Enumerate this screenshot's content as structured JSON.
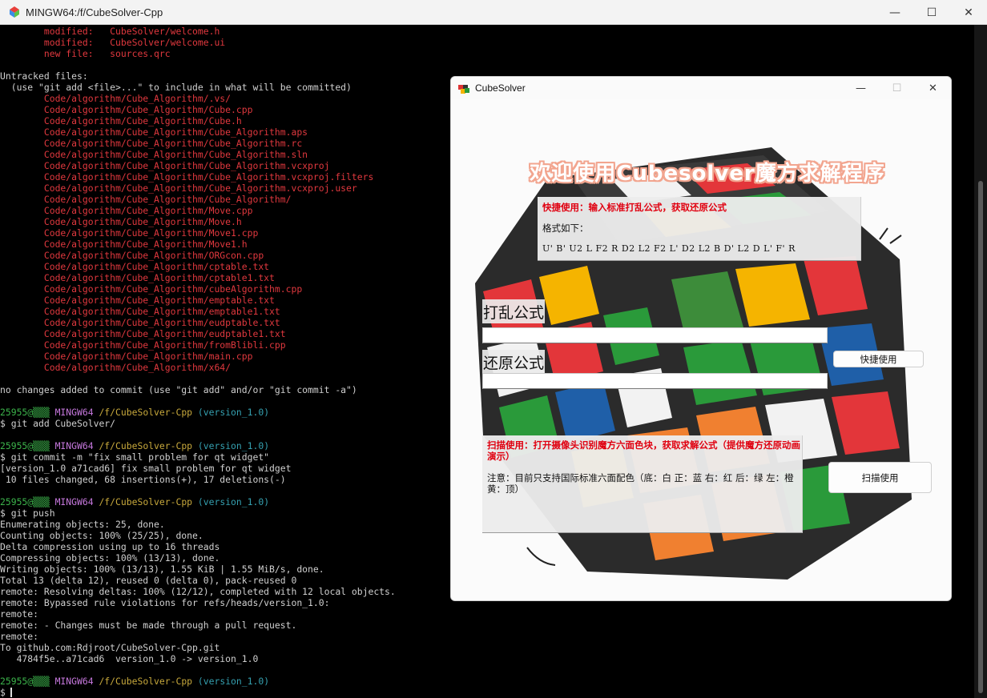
{
  "terminal_window": {
    "title": "MINGW64:/f/CubeSolver-Cpp",
    "controls": {
      "minimize": "—",
      "maximize": "☐",
      "close": "✕"
    }
  },
  "terminal": {
    "lines": [
      [
        [
          "c-red",
          "        modified:   CubeSolver/welcome.h"
        ]
      ],
      [
        [
          "c-red",
          "        modified:   CubeSolver/welcome.ui"
        ]
      ],
      [
        [
          "c-red",
          "        new file:   sources.qrc"
        ]
      ],
      [
        [
          "c-white",
          ""
        ]
      ],
      [
        [
          "c-white",
          "Untracked files:"
        ]
      ],
      [
        [
          "c-white",
          "  (use \"git add <file>...\" to include in what will be committed)"
        ]
      ],
      [
        [
          "c-red",
          "        Code/algorithm/Cube_Algorithm/.vs/"
        ]
      ],
      [
        [
          "c-red",
          "        Code/algorithm/Cube_Algorithm/Cube.cpp"
        ]
      ],
      [
        [
          "c-red",
          "        Code/algorithm/Cube_Algorithm/Cube.h"
        ]
      ],
      [
        [
          "c-red",
          "        Code/algorithm/Cube_Algorithm/Cube_Algorithm.aps"
        ]
      ],
      [
        [
          "c-red",
          "        Code/algorithm/Cube_Algorithm/Cube_Algorithm.rc"
        ]
      ],
      [
        [
          "c-red",
          "        Code/algorithm/Cube_Algorithm/Cube_Algorithm.sln"
        ]
      ],
      [
        [
          "c-red",
          "        Code/algorithm/Cube_Algorithm/Cube_Algorithm.vcxproj"
        ]
      ],
      [
        [
          "c-red",
          "        Code/algorithm/Cube_Algorithm/Cube_Algorithm.vcxproj.filters"
        ]
      ],
      [
        [
          "c-red",
          "        Code/algorithm/Cube_Algorithm/Cube_Algorithm.vcxproj.user"
        ]
      ],
      [
        [
          "c-red",
          "        Code/algorithm/Cube_Algorithm/Cube_Algorithm/"
        ]
      ],
      [
        [
          "c-red",
          "        Code/algorithm/Cube_Algorithm/Move.cpp"
        ]
      ],
      [
        [
          "c-red",
          "        Code/algorithm/Cube_Algorithm/Move.h"
        ]
      ],
      [
        [
          "c-red",
          "        Code/algorithm/Cube_Algorithm/Move1.cpp"
        ]
      ],
      [
        [
          "c-red",
          "        Code/algorithm/Cube_Algorithm/Move1.h"
        ]
      ],
      [
        [
          "c-red",
          "        Code/algorithm/Cube_Algorithm/ORGcon.cpp"
        ]
      ],
      [
        [
          "c-red",
          "        Code/algorithm/Cube_Algorithm/cptable.txt"
        ]
      ],
      [
        [
          "c-red",
          "        Code/algorithm/Cube_Algorithm/cptable1.txt"
        ]
      ],
      [
        [
          "c-red",
          "        Code/algorithm/Cube_Algorithm/cubeAlgorithm.cpp"
        ]
      ],
      [
        [
          "c-red",
          "        Code/algorithm/Cube_Algorithm/emptable.txt"
        ]
      ],
      [
        [
          "c-red",
          "        Code/algorithm/Cube_Algorithm/emptable1.txt"
        ]
      ],
      [
        [
          "c-red",
          "        Code/algorithm/Cube_Algorithm/eudptable.txt"
        ]
      ],
      [
        [
          "c-red",
          "        Code/algorithm/Cube_Algorithm/eudptable1.txt"
        ]
      ],
      [
        [
          "c-red",
          "        Code/algorithm/Cube_Algorithm/fromBlibli.cpp"
        ]
      ],
      [
        [
          "c-red",
          "        Code/algorithm/Cube_Algorithm/main.cpp"
        ]
      ],
      [
        [
          "c-red",
          "        Code/algorithm/Cube_Algorithm/x64/"
        ]
      ],
      [
        [
          "c-white",
          ""
        ]
      ],
      [
        [
          "c-white",
          "no changes added to commit (use \"git add\" and/or \"git commit -a\")"
        ]
      ],
      [
        [
          "c-white",
          ""
        ]
      ],
      [
        [
          "c-green",
          "25955@▒▒▒ "
        ],
        [
          "c-purple",
          "MINGW64 "
        ],
        [
          "c-yellow",
          "/f/CubeSolver-Cpp "
        ],
        [
          "c-cyan",
          "(version_1.0)"
        ]
      ],
      [
        [
          "c-white",
          "$ git add CubeSolver/"
        ]
      ],
      [
        [
          "c-white",
          ""
        ]
      ],
      [
        [
          "c-green",
          "25955@▒▒▒ "
        ],
        [
          "c-purple",
          "MINGW64 "
        ],
        [
          "c-yellow",
          "/f/CubeSolver-Cpp "
        ],
        [
          "c-cyan",
          "(version_1.0)"
        ]
      ],
      [
        [
          "c-white",
          "$ git commit -m \"fix small problem for qt widget\""
        ]
      ],
      [
        [
          "c-white",
          "[version_1.0 a71cad6] fix small problem for qt widget"
        ]
      ],
      [
        [
          "c-white",
          " 10 files changed, 68 insertions(+), 17 deletions(-)"
        ]
      ],
      [
        [
          "c-white",
          ""
        ]
      ],
      [
        [
          "c-green",
          "25955@▒▒▒ "
        ],
        [
          "c-purple",
          "MINGW64 "
        ],
        [
          "c-yellow",
          "/f/CubeSolver-Cpp "
        ],
        [
          "c-cyan",
          "(version_1.0)"
        ]
      ],
      [
        [
          "c-white",
          "$ git push"
        ]
      ],
      [
        [
          "c-white",
          "Enumerating objects: 25, done."
        ]
      ],
      [
        [
          "c-white",
          "Counting objects: 100% (25/25), done."
        ]
      ],
      [
        [
          "c-white",
          "Delta compression using up to 16 threads"
        ]
      ],
      [
        [
          "c-white",
          "Compressing objects: 100% (13/13), done."
        ]
      ],
      [
        [
          "c-white",
          "Writing objects: 100% (13/13), 1.55 KiB | 1.55 MiB/s, done."
        ]
      ],
      [
        [
          "c-white",
          "Total 13 (delta 12), reused 0 (delta 0), pack-reused 0"
        ]
      ],
      [
        [
          "c-white",
          "remote: Resolving deltas: 100% (12/12), completed with 12 local objects."
        ]
      ],
      [
        [
          "c-white",
          "remote: Bypassed rule violations for refs/heads/version_1.0:"
        ]
      ],
      [
        [
          "c-white",
          "remote:"
        ]
      ],
      [
        [
          "c-white",
          "remote: - Changes must be made through a pull request."
        ]
      ],
      [
        [
          "c-white",
          "remote:"
        ]
      ],
      [
        [
          "c-white",
          "To github.com:Rdjroot/CubeSolver-Cpp.git"
        ]
      ],
      [
        [
          "c-white",
          "   4784f5e..a71cad6  version_1.0 -> version_1.0"
        ]
      ],
      [
        [
          "c-white",
          ""
        ]
      ],
      [
        [
          "c-green",
          "25955@▒▒▒ "
        ],
        [
          "c-purple",
          "MINGW64 "
        ],
        [
          "c-yellow",
          "/f/CubeSolver-Cpp "
        ],
        [
          "c-cyan",
          "(version_1.0)"
        ]
      ],
      [
        [
          "c-white",
          "$"
        ]
      ]
    ]
  },
  "cubesolver": {
    "title": "CubeSolver",
    "controls": {
      "minimize": "—",
      "maximize": "☐",
      "close": "✕"
    },
    "welcome_title": "欢迎使用Cubesolver魔方求解程序",
    "quick": {
      "heading": "快捷使用：输入标准打乱公式，获取还原公式",
      "format_label": "格式如下：",
      "format_example": "U' B' U2 L F2 R D2 L2 F2 L' D2 L2 B D' L2 D L' F' R"
    },
    "scramble_label": "打乱公式",
    "restore_label": "还原公式",
    "scramble_value": "",
    "restore_value": "",
    "quick_button": "快捷使用",
    "scan": {
      "heading": "扫描使用：打开摄像头识别魔方六面色块，获取求解公式（提供魔方还原动画演示）",
      "note": "注意：目前只支持国际标准六面配色（底：白 正：蓝 右：红 后：绿 左：橙 黄：顶）"
    },
    "scan_button": "扫描使用"
  },
  "colors": {
    "terminal_bg": "#000000",
    "error_red": "#e00010",
    "prompt_green": "#3cb44b",
    "prompt_purple": "#c678dd",
    "prompt_yellow": "#c8a93c",
    "prompt_cyan": "#35a0b0"
  }
}
